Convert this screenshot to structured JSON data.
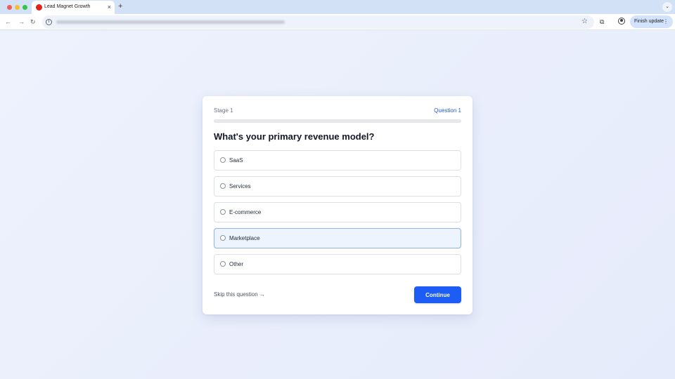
{
  "browser": {
    "tab_title": "Lead Magnet Growth",
    "tab_close_glyph": "×",
    "new_tab_glyph": "+",
    "tabstrip_menu_glyph": "⌄",
    "back_glyph": "←",
    "forward_glyph": "→",
    "reload_glyph": "↻",
    "info_glyph": "i",
    "bookmark_glyph": "☆",
    "extensions_glyph": "⧉",
    "finish_update_label": "Finish update",
    "kebab_glyph": "⋮",
    "favicon_color": "#e3211b"
  },
  "quiz": {
    "stage_label": "Stage 1",
    "question_label": "Question 1",
    "progress_fraction": 0,
    "title": "What's your primary revenue model?",
    "options": [
      {
        "label": "SaaS",
        "selected": false
      },
      {
        "label": "Services",
        "selected": false
      },
      {
        "label": "E-commerce",
        "selected": false
      },
      {
        "label": "Marketplace",
        "selected": true
      },
      {
        "label": "Other",
        "selected": false
      }
    ],
    "skip_label": "Skip this question →",
    "continue_label": "Continue"
  },
  "colors": {
    "accent": "#1d5cf5",
    "question_link": "#2458d6",
    "selected_bg": "#eef4fe",
    "selected_border": "#8fb3e8"
  }
}
